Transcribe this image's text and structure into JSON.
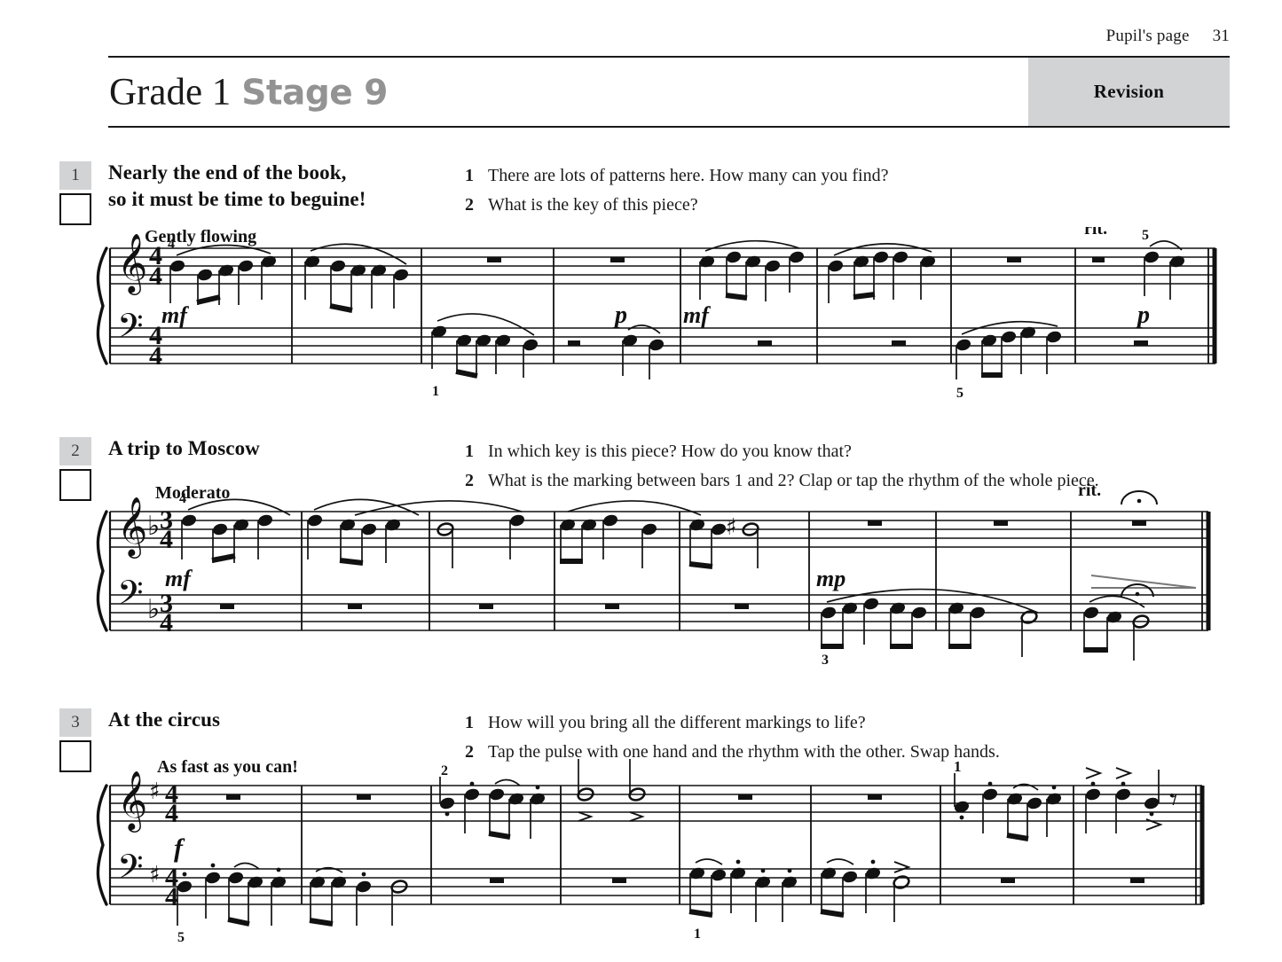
{
  "page": {
    "folio_label": "Pupil's page",
    "folio_number": "31"
  },
  "header": {
    "grade": "Grade 1",
    "stage": "Stage 9",
    "badge": "Revision",
    "tint_color": "#d2d3d5",
    "stage_color": "#939393"
  },
  "exercises": [
    {
      "number": "1",
      "title": "Nearly the end of the book,\nso it must be time to beguine!",
      "questions": [
        {
          "num": "1",
          "text": "There are lots of patterns here. How many can you find?"
        },
        {
          "num": "2",
          "text": "What is the key of this piece?"
        }
      ],
      "music": {
        "tempo": "Gently flowing",
        "time_signature": "4/4",
        "key_signature": "none",
        "treble_clef": "treble-clef",
        "bass_clef": "bass-clef",
        "bars": 8,
        "dynamics": [
          "mf",
          "p",
          "mf",
          "p"
        ],
        "expression": [
          "rit."
        ],
        "fingerings": [
          "4",
          "1",
          "5",
          "5"
        ],
        "final_barline": "double-thin-thick"
      }
    },
    {
      "number": "2",
      "title": "A trip to Moscow",
      "questions": [
        {
          "num": "1",
          "text": "In which key is this piece? How do you know that?"
        },
        {
          "num": "2",
          "text": "What is the marking between bars 1 and 2? Clap or tap the rhythm of the whole piece."
        }
      ],
      "music": {
        "tempo": "Moderato",
        "time_signature": "3/4",
        "key_signature": "one-flat",
        "treble_clef": "treble-clef",
        "bass_clef": "bass-clef",
        "bars": 8,
        "dynamics": [
          "mf",
          "mp"
        ],
        "expression": [
          "rit.",
          "fermata",
          "diminuendo"
        ],
        "fingerings": [
          "4",
          "3"
        ],
        "final_barline": "double-thin-thick"
      }
    },
    {
      "number": "3",
      "title": "At the circus",
      "questions": [
        {
          "num": "1",
          "text": "How will you bring all the different markings to life?"
        },
        {
          "num": "2",
          "text": "Tap the pulse with one hand and the rhythm with the other. Swap hands."
        }
      ],
      "music": {
        "tempo": "As fast as you can!",
        "time_signature": "4/4",
        "key_signature": "one-sharp",
        "treble_clef": "treble-clef",
        "bass_clef": "bass-clef",
        "bars": 8,
        "dynamics": [
          "f"
        ],
        "expression": [
          "staccato",
          "accent",
          "quarter-rest"
        ],
        "fingerings": [
          "5",
          "2",
          "1",
          "1"
        ],
        "final_barline": "double-thin-thick"
      }
    }
  ]
}
